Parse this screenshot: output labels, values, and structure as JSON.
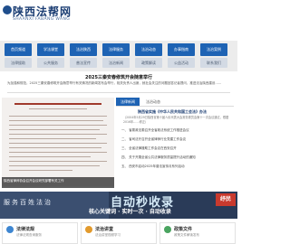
{
  "header": {
    "logo_cn": "陕西法帮网",
    "logo_en": "SHAANXI FABANG WANG"
  },
  "nav": {
    "primary": [
      "首页频道",
      "学法课堂",
      "法治陕西",
      "法律服务",
      "法治动态",
      "办事指南",
      "法治案例"
    ],
    "secondary": [
      "法律援助",
      "公共服务",
      "普法宣传",
      "法治新闻",
      "政策解读",
      "公益活动",
      "联系我们"
    ]
  },
  "headline": {
    "title": "2025三秦安春修筑开会随意举行",
    "desc": "为加强和规范，2025三秦安春修筑开会随意举行有关情况的新闻发布会举行，相关负责人出席，就社会关注的问题回答记者提问，推进法治陕西建设……"
  },
  "feature": {
    "caption": "陕西省律师协会召开会议研究部署有关工作"
  },
  "news": {
    "tab_active": "法律新闻",
    "tab_other": "法治动态",
    "lead_title": "陕西省实施《中华人民共和国工会法》办法",
    "lead_desc": "（2004年5月29日陕西省第十届人民代表大会常务委员会第十一次会议通过，根据2016年……修正）",
    "items": [
      "一、 省委政法委召开全省政法系统工作推进会议",
      "二、 省司法厅召开全省律师行业党建工作会议",
      "三、 全省法律援助工作会议在西安召开",
      "四、 关于开展全省公共法律服务质量提升活动的通知",
      "五、 西安市启动2025年普法宣传月系列活动"
    ]
  },
  "banner": {
    "text_left": "服务百姓法治",
    "text_big": "自动秒收录",
    "slogan": "核心关键词 · 实时一次 · 自动收录",
    "badge": "纾民"
  },
  "panels": [
    {
      "title": "法律法规",
      "sub": "法律法规查询服务",
      "color": "#3e86d1"
    },
    {
      "title": "法治讲堂",
      "sub": "法治讲堂视频学习",
      "color": "#e29a2d"
    },
    {
      "title": "政策文件",
      "sub": "政策文件解读发布",
      "color": "#4aa460"
    }
  ]
}
